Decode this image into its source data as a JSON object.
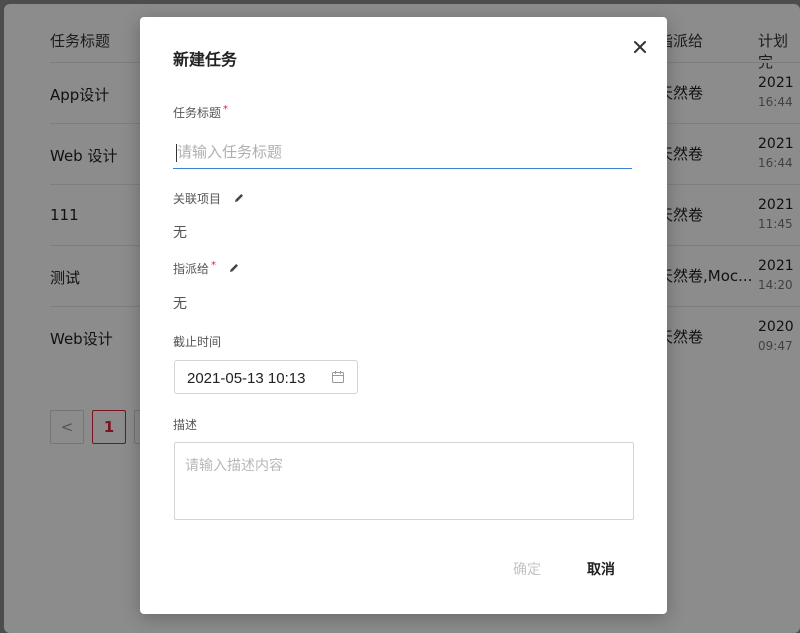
{
  "background": {
    "headers": {
      "title": "任务标题",
      "assignee": "指派给",
      "plan": "计划完"
    },
    "rows": [
      {
        "title": "App设计",
        "assignee": "天然卷",
        "date": "2021",
        "time": "16:44"
      },
      {
        "title": "Web 设计",
        "assignee": "天然卷",
        "date": "2021",
        "time": "16:44"
      },
      {
        "title": "111",
        "assignee": "天然卷",
        "date": "2021",
        "time": "11:45"
      },
      {
        "title": "测试",
        "assignee": "天然卷,Moc...",
        "date": "2021",
        "time": "14:20"
      },
      {
        "title": "Web设计",
        "assignee": "天然卷",
        "date": "2020",
        "time": "09:47"
      }
    ],
    "pager": {
      "prev": "<",
      "current": "1",
      "next": ""
    }
  },
  "modal": {
    "title": "新建任务",
    "close": "✕",
    "task_title": {
      "label": "任务标题",
      "required": "*",
      "placeholder": "请输入任务标题",
      "value": ""
    },
    "project": {
      "label": "关联项目",
      "value": "无"
    },
    "assignee": {
      "label": "指派给",
      "required": "*",
      "value": "无"
    },
    "deadline": {
      "label": "截止时间",
      "value": "2021-05-13 10:13"
    },
    "description": {
      "label": "描述",
      "placeholder": "请输入描述内容",
      "value": ""
    },
    "buttons": {
      "confirm": "确定",
      "cancel": "取消"
    }
  },
  "colors": {
    "accent": "#3a82d6",
    "required": "#e0243d",
    "pager_active": "#e0243d"
  }
}
